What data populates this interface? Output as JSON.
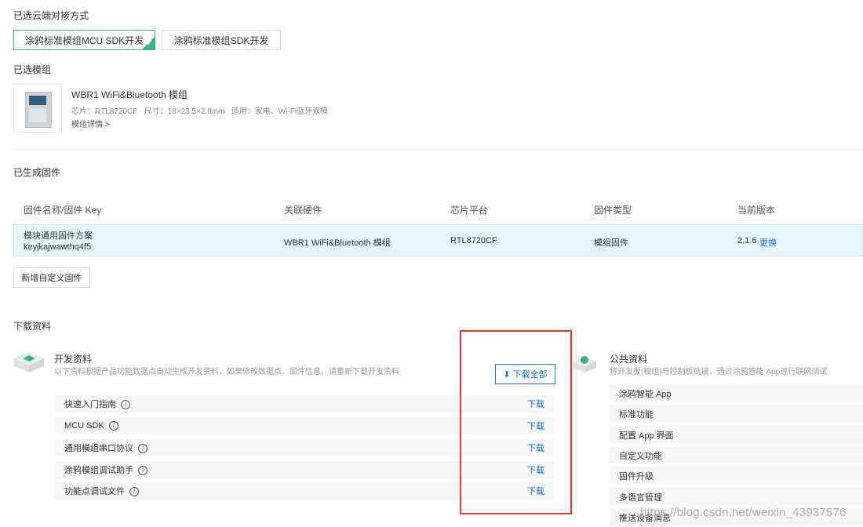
{
  "connect": {
    "title": "已选云端对接方式",
    "options": [
      {
        "label": "涂鸦标准模组MCU SDK开发",
        "selected": true
      },
      {
        "label": "涂鸦标准模组SDK开发",
        "selected": false
      }
    ]
  },
  "module": {
    "title": "已选模组",
    "name": "WBR1 WiFi&Bluetooth 模组",
    "specs": "芯片：RTL8720CF   尺寸：18×23.5×2.9mm   适用：家电、Wi-Fi蓝牙双模",
    "details_link": "模组详情 >"
  },
  "firmware": {
    "title": "已生成固件",
    "headers": [
      "固件名称/固件 Key",
      "关联硬件",
      "芯片平台",
      "固件类型",
      "当前版本"
    ],
    "row": {
      "name": "模块通用固件方案",
      "key": "keyjkajwawthq4f5",
      "hardware": "WBR1 WiFi&Bluetooth 模组",
      "chip": "RTL8720CF",
      "type": "模组固件",
      "version": "2.1.6",
      "change": "更换"
    },
    "add_button": "新增自定义固件"
  },
  "downloads": {
    "title": "下载资料",
    "dev": {
      "title": "开发资料",
      "desc": "以下资料根据产品功能数据点自动生成开发资料，如果修改数据点、固件信息，请重新下载开发资料",
      "download_all": "下载全部",
      "items": [
        {
          "label": "快速入门指南",
          "action": "下载"
        },
        {
          "label": "MCU SDK",
          "action": "下载"
        },
        {
          "label": "通用模组串口协议",
          "action": "下载"
        },
        {
          "label": "涂鸦模组调试助手",
          "action": "下载"
        },
        {
          "label": "功能点调试文件",
          "action": "下载"
        }
      ]
    },
    "public": {
      "title": "公共资料",
      "desc": "将开发板(模组)与控制板链接，通过涂鸦智能 App进行联网测试",
      "items": [
        "涂鸦智能 App",
        "标准功能",
        "配置 App 界面",
        "自定义功能",
        "固件升级",
        "多语言管理",
        "推送设备消息"
      ]
    }
  },
  "watermark": "https://blog.csdn.net/weixin_43937576",
  "colors": {
    "accent_green": "#36b37e",
    "link_blue": "#1a73e8",
    "highlight": "#e6f7ff",
    "annotation_red": "#e53935"
  }
}
